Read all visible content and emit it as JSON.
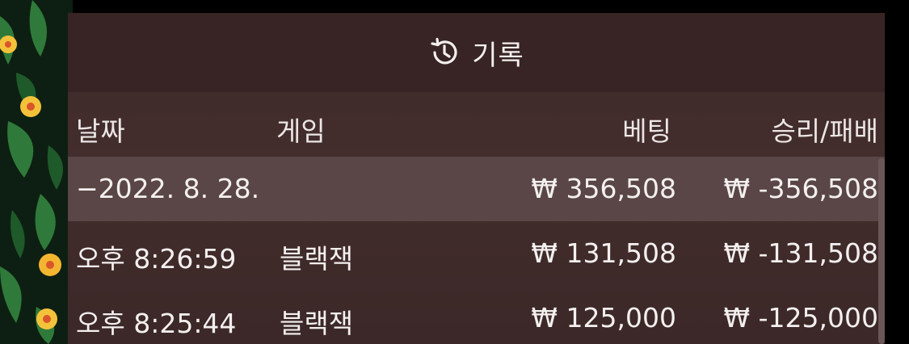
{
  "header": {
    "icon": "history-icon",
    "title": "기록"
  },
  "columns": {
    "date": "날짜",
    "game": "게임",
    "bet": "베팅",
    "result": "승리/패배"
  },
  "group": {
    "date": "−2022. 8. 28.",
    "game": "",
    "bet": "₩ 356,508",
    "result": "₩ -356,508"
  },
  "rows": [
    {
      "time": "오후 8:26:59",
      "game": "블랙잭",
      "bet": "₩ 131,508",
      "result": "₩ -131,508"
    },
    {
      "time": "오후 8:25:44",
      "game": "블랙잭",
      "bet": "₩ 125,000",
      "result": "₩ -125,000"
    }
  ],
  "colors": {
    "panel": "#412b2b",
    "header": "#382424",
    "group_row": "#5a4646",
    "text": "#f3f0ef"
  }
}
